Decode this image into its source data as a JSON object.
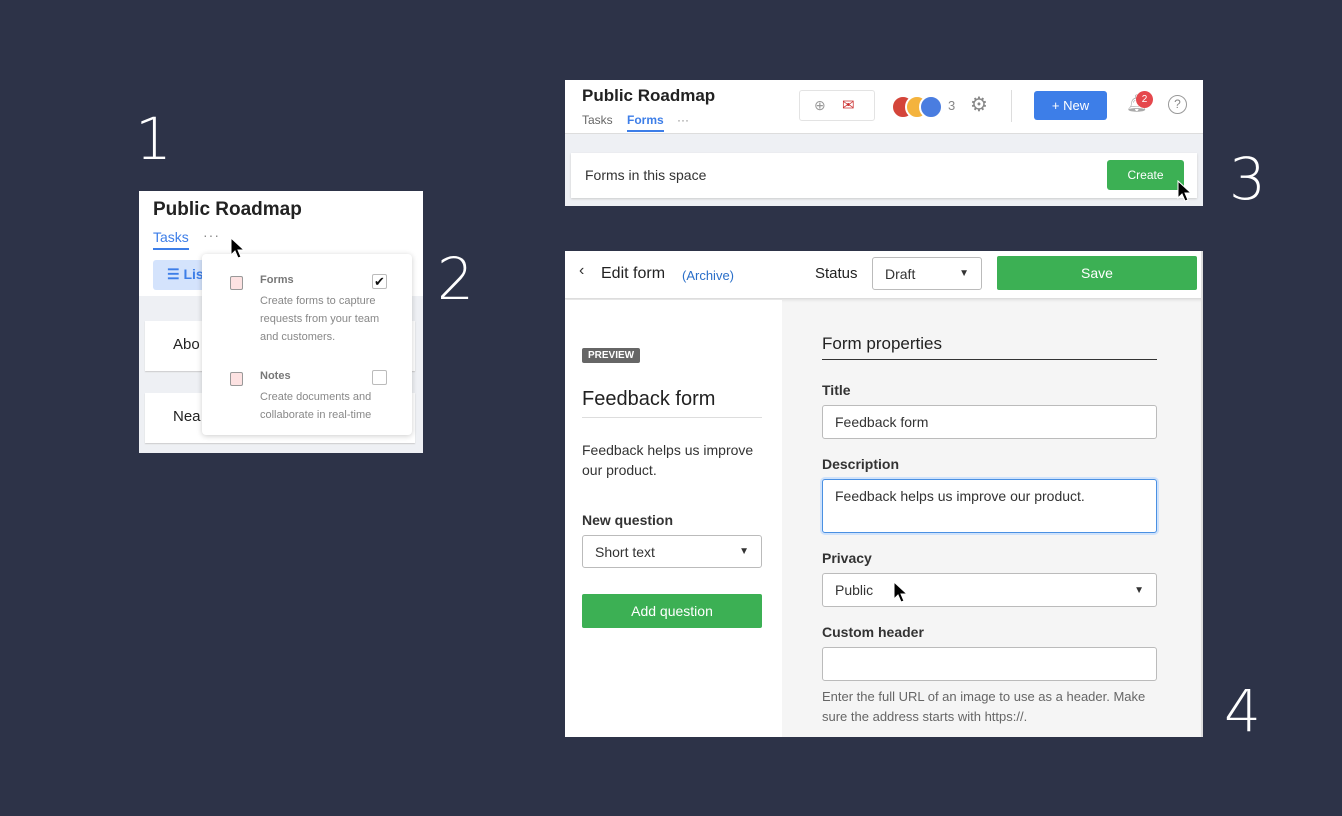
{
  "step_numbers": [
    "1",
    "2",
    "3",
    "4"
  ],
  "panel1": {
    "title": "Public Roadmap",
    "tabs": [
      "Tasks"
    ],
    "more": "···",
    "list_button": "Lis",
    "cards": [
      "Abo",
      "Nea"
    ],
    "menu": [
      {
        "label": "Forms",
        "description": "Create forms to capture requests from your team and customers.",
        "checked": true,
        "icon": "clipboard-icon"
      },
      {
        "label": "Notes",
        "description": "Create documents and collaborate in real-time",
        "checked": false,
        "icon": "document-icon"
      }
    ]
  },
  "panel3": {
    "title": "Public Roadmap",
    "tabs": [
      "Tasks",
      "Forms"
    ],
    "active_tab": "Forms",
    "more": "···",
    "member_count": "3",
    "new_button": "+ New",
    "notification_count": "2",
    "section_label": "Forms in this space",
    "create_button": "Create"
  },
  "panel4": {
    "back_label": "Edit form",
    "archive_link": "(Archive)",
    "status_label": "Status",
    "status_value": "Draft",
    "save_button": "Save",
    "preview": {
      "badge": "PREVIEW",
      "title": "Feedback form",
      "description": "Feedback helps us improve our product.",
      "new_question_label": "New question",
      "question_type": "Short text",
      "add_question_button": "Add question"
    },
    "properties": {
      "heading": "Form properties",
      "title_label": "Title",
      "title_value": "Feedback form",
      "description_label": "Description",
      "description_value": "Feedback helps us improve our product.",
      "privacy_label": "Privacy",
      "privacy_value": "Public",
      "custom_header_label": "Custom header",
      "custom_header_value": "",
      "custom_header_help": "Enter the full URL of an image to use as a header. Make sure the address starts with https://."
    }
  },
  "colors": {
    "background": "#2d3348",
    "accent": "#3d7ee8",
    "green": "#3cb054",
    "badge": "#e5484d"
  }
}
